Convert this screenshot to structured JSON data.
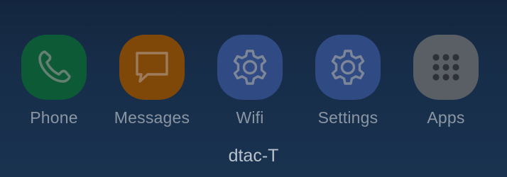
{
  "dock": {
    "apps": [
      {
        "label": "Phone",
        "icon": "phone-icon",
        "color": "#0d5a36"
      },
      {
        "label": "Messages",
        "icon": "message-bubble-icon",
        "color": "#7f4808"
      },
      {
        "label": "Wifi",
        "icon": "gear-icon",
        "color": "#304a84"
      },
      {
        "label": "Settings",
        "icon": "gear-icon",
        "color": "#304a84"
      },
      {
        "label": "Apps",
        "icon": "app-grid-icon",
        "color": "#5a5f66"
      }
    ]
  },
  "status": {
    "carrier": "dtac-T"
  }
}
